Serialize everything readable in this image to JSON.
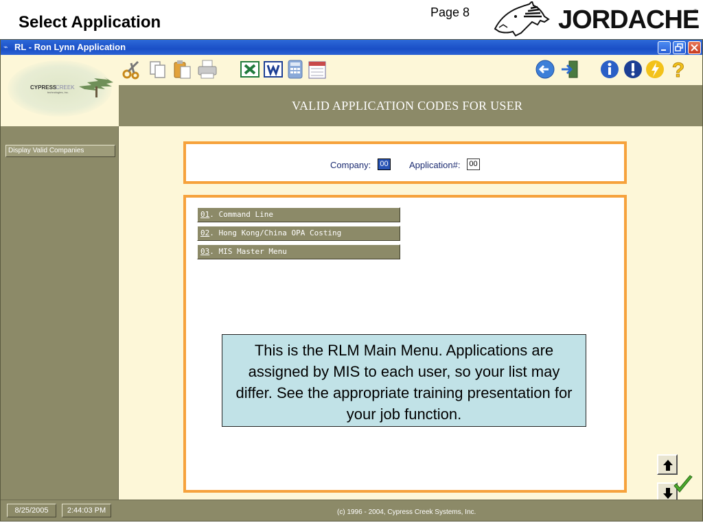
{
  "slide": {
    "title": "Select Application",
    "page": "Page 8",
    "brand": "JORDACHE",
    "brand_mark": "®"
  },
  "window": {
    "title": "RL - Ron Lynn Application",
    "title_icon": "app-icon",
    "controls": [
      "minimize",
      "restore",
      "close"
    ]
  },
  "logo": {
    "name_part1": "CYPRESS",
    "name_part2": "CREEK",
    "sub": "technologies, inc."
  },
  "toolbar": {
    "icons": [
      "cut-icon",
      "copy-icon",
      "paste-icon",
      "print-icon",
      "excel-icon",
      "word-icon",
      "calculator-icon",
      "calendar-icon",
      "back-icon",
      "exit-icon",
      "info-icon",
      "alert-icon",
      "tips-icon",
      "help-icon"
    ]
  },
  "header": {
    "text": "VALID APPLICATION CODES FOR USER"
  },
  "sidebar": {
    "button_label": "Display Valid Companies"
  },
  "form": {
    "company_label": "Company:",
    "company_value": "00",
    "application_label": "Application#:",
    "application_value": "00"
  },
  "menu": {
    "items": [
      {
        "code": "01",
        "label": ". Command Line"
      },
      {
        "code": "02",
        "label": ". Hong Kong/China OPA Costing"
      },
      {
        "code": "03",
        "label": ". MIS Master Menu"
      }
    ]
  },
  "status": {
    "date": "8/25/2005",
    "time": "2:44:03 PM",
    "copyright": "(c) 1996 - 2004, Cypress Creek Systems, Inc."
  },
  "callout": {
    "text": "This is the RLM Main Menu. Applications are assigned by MIS to each user, so your list may differ. See the appropriate training presentation for your job function."
  },
  "colors": {
    "panel": "#8c8a68",
    "cream": "#fdf7d8",
    "orange_border": "#f6a23c",
    "callout_bg": "#c1e2e7",
    "titlebar": "#1a4fc6"
  }
}
